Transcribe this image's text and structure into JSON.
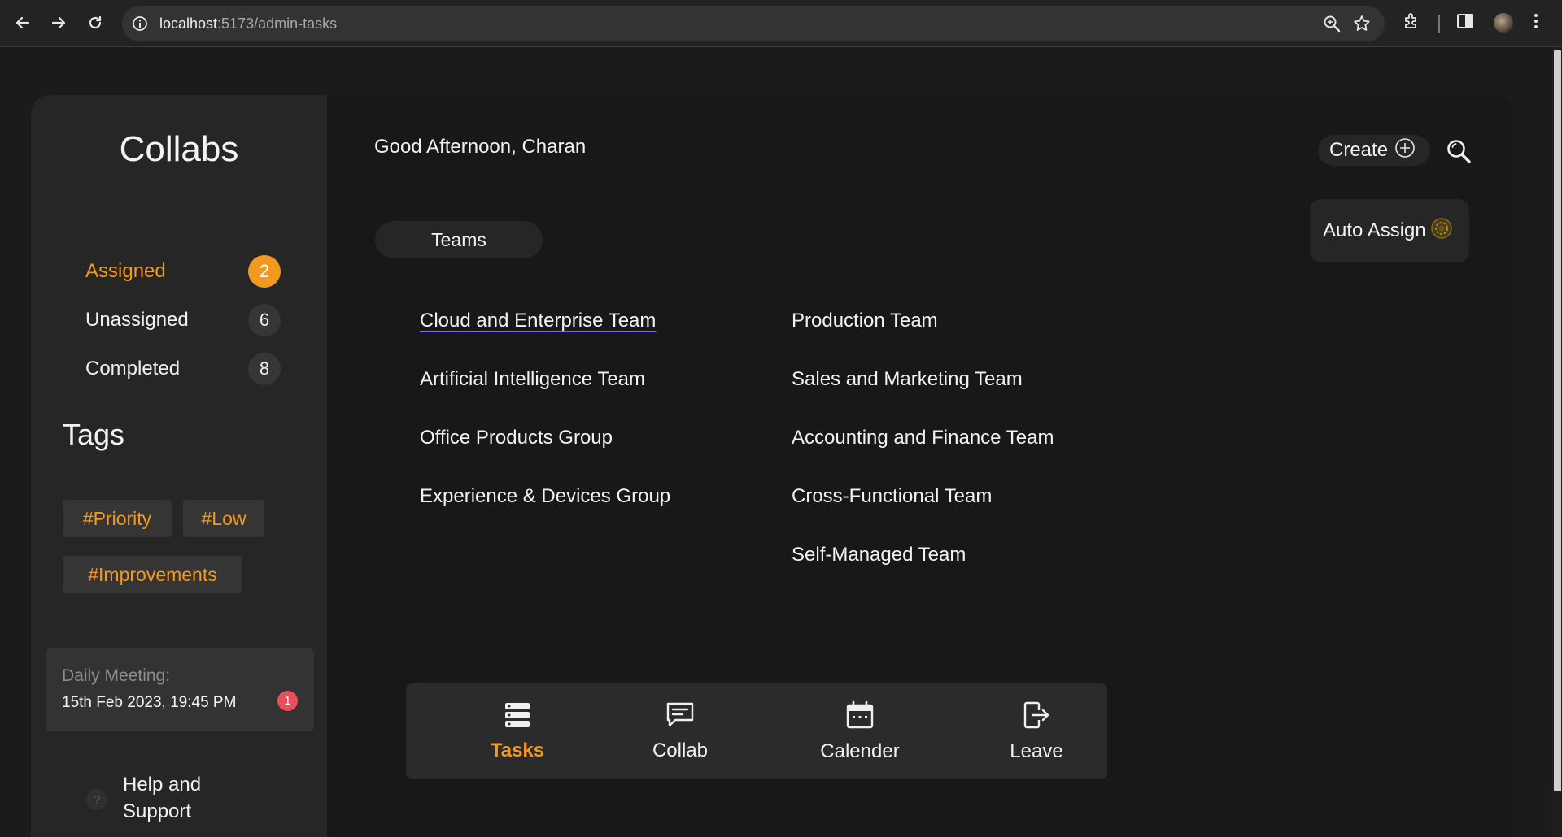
{
  "browser": {
    "url_host": "localhost",
    "url_path": ":5173/admin-tasks"
  },
  "sidebar": {
    "brand": "Collabs",
    "statuses": [
      {
        "label": "Assigned",
        "count": "2"
      },
      {
        "label": "Unassigned",
        "count": "6"
      },
      {
        "label": "Completed",
        "count": "8"
      }
    ],
    "tags_title": "Tags",
    "tags": [
      "#Priority",
      "#Low",
      "#Improvements"
    ],
    "meeting": {
      "title": "Daily Meeting:",
      "time": "15th Feb 2023, 19:45 PM",
      "alert_count": "1"
    },
    "help_label": "Help and Support"
  },
  "header": {
    "greeting": "Good Afternoon, Charan",
    "create_label": "Create",
    "auto_assign_label": "Auto Assign"
  },
  "teams": {
    "tab_label": "Teams",
    "left_column": [
      "Cloud and Enterprise Team",
      "Artificial Intelligence Team",
      "Office Products Group",
      "Experience & Devices Group"
    ],
    "right_column": [
      "Production Team",
      "Sales and Marketing Team",
      "Accounting and Finance Team",
      "Cross-Functional Team",
      "Self-Managed Team"
    ]
  },
  "bottom_nav": {
    "items": [
      {
        "label": "Tasks",
        "icon": "tasks-stack-icon"
      },
      {
        "label": "Collab",
        "icon": "chat-icon"
      },
      {
        "label": "Calender",
        "icon": "calendar-icon"
      },
      {
        "label": "Leave",
        "icon": "exit-icon"
      }
    ]
  },
  "colors": {
    "accent": "#f29a1f",
    "alert": "#e8505b",
    "link_underline": "#7b6fff"
  }
}
